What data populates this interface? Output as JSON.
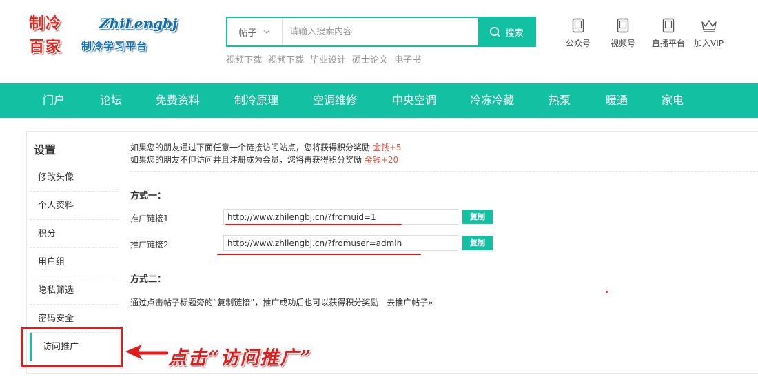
{
  "logo": {
    "line1": "制冷",
    "line2": "百家",
    "en": "ZhiLengbj",
    "slogan": "制冷学习平台"
  },
  "search": {
    "type_label": "帖子",
    "placeholder": "请输入搜索内容",
    "button_label": "搜索",
    "hotwords": [
      "视频下载",
      "视频下载",
      "毕业设计",
      "硕士论文",
      "电子书"
    ]
  },
  "quick_links": [
    {
      "label": "公众号",
      "icon": "tablet-icon"
    },
    {
      "label": "视频号",
      "icon": "tablet-icon"
    },
    {
      "label": "直播平台",
      "icon": "tablet-icon"
    },
    {
      "label": "加入VIP",
      "icon": "crown-icon"
    }
  ],
  "nav": [
    "门户",
    "论坛",
    "免费资料",
    "制冷原理",
    "空调维修",
    "中央空调",
    "冷冻冷藏",
    "热泵",
    "暖通",
    "家电"
  ],
  "sidebar": {
    "title": "设置",
    "items": [
      "修改头像",
      "个人资料",
      "积分",
      "用户组",
      "隐私筛选",
      "密码安全",
      "访问推广"
    ],
    "active_index": 6
  },
  "promo": {
    "notice1_text": "如果您的朋友通过下面任意一个链接访问站点，您将获得积分奖励",
    "notice1_reward": "金钱+5",
    "notice2_text": "如果您的朋友不但访问并且注册成为会员，您将再获得积分奖励",
    "notice2_reward": "金钱+20",
    "method1_title": "方式一：",
    "link1_label": "推广链接1",
    "link1_value": "http://www.zhilengbj.cn/?fromuid=1",
    "link2_label": "推广链接2",
    "link2_value": "http://www.zhilengbj.cn/?fromuser=admin",
    "copy_label": "复制",
    "method2_title": "方式二：",
    "method2_text": "通过点击帖子标题旁的“复制链接”，推广成功后也可以获得积分奖励",
    "method2_link": "去推广帖子»"
  },
  "annotation": {
    "text": "点击“访问推广”",
    "color": "#e11a1a"
  },
  "colors": {
    "accent": "#13c1a2",
    "reward": "#e2523f"
  }
}
